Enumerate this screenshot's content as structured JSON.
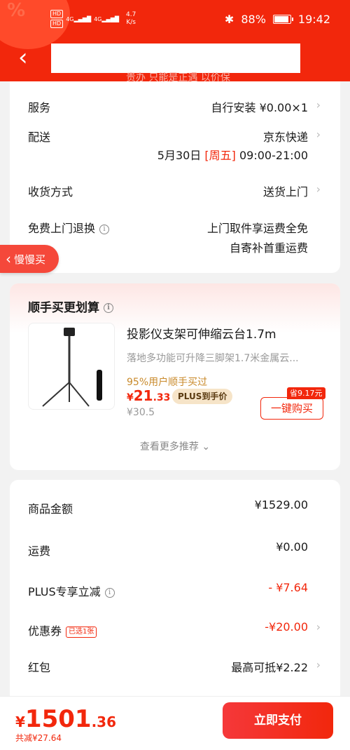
{
  "status_bar": {
    "hd1": "HD",
    "hd2": "HD",
    "net1": "4G",
    "net2": "4G",
    "speed_value": "4.7",
    "speed_unit": "K/s",
    "bluetooth": "✱",
    "battery": "88%",
    "time": "19:42"
  },
  "header": {
    "back_glyph": "‹",
    "peek_text": "贵办 只能是正遇 以价保"
  },
  "services": {
    "rows": [
      {
        "label": "服务",
        "value": "自行安装 ¥0.00×1"
      },
      {
        "label": "配送",
        "value": "京东快递"
      },
      {
        "label": "收货方式",
        "value": "送货上门"
      },
      {
        "label": "免费上门退换",
        "value_line1": "上门取件享运费全免",
        "value_line2": "自寄补首重运费"
      }
    ],
    "delivery_date": "5月30日",
    "delivery_weekday": "[周五]",
    "delivery_time": "09:00-21:00",
    "info_glyph": "i"
  },
  "slow_buy": {
    "label": "慢慢买",
    "chevron": "‹"
  },
  "recommend": {
    "title": "顺手买更划算",
    "product": {
      "name": "投影仪支架可伸缩云台1.7m",
      "subtitle": "落地多功能可升降三脚架1.7米金属云...",
      "buy_rate": "95%用户顺手买过",
      "currency": "¥",
      "price_int": "21",
      "price_dec": ".33",
      "plus_label": "PLUS到手价",
      "original_price": "¥30.5",
      "save_tag": "省9.17元",
      "buy_button": "一键购买"
    },
    "more": "查看更多推荐 ⌄"
  },
  "summary": {
    "rows": [
      {
        "label": "商品金额",
        "value": "¥1529.00"
      },
      {
        "label": "运费",
        "value": "¥0.00"
      },
      {
        "label": "PLUS专享立减",
        "value": "- ¥7.64"
      },
      {
        "label": "优惠券",
        "tag": "已选1张",
        "value": "-¥20.00"
      },
      {
        "label": "红包",
        "value": "最高可抵¥2.22"
      }
    ]
  },
  "bottom": {
    "currency": "¥",
    "total_int": "1501",
    "total_dec": ".36",
    "saved": "共减¥27.64",
    "pay_button": "立即支付"
  },
  "colors": {
    "brand_red": "#f2270c",
    "gold_text": "#c98a2b",
    "plus_bg": "#f6e4c8"
  }
}
